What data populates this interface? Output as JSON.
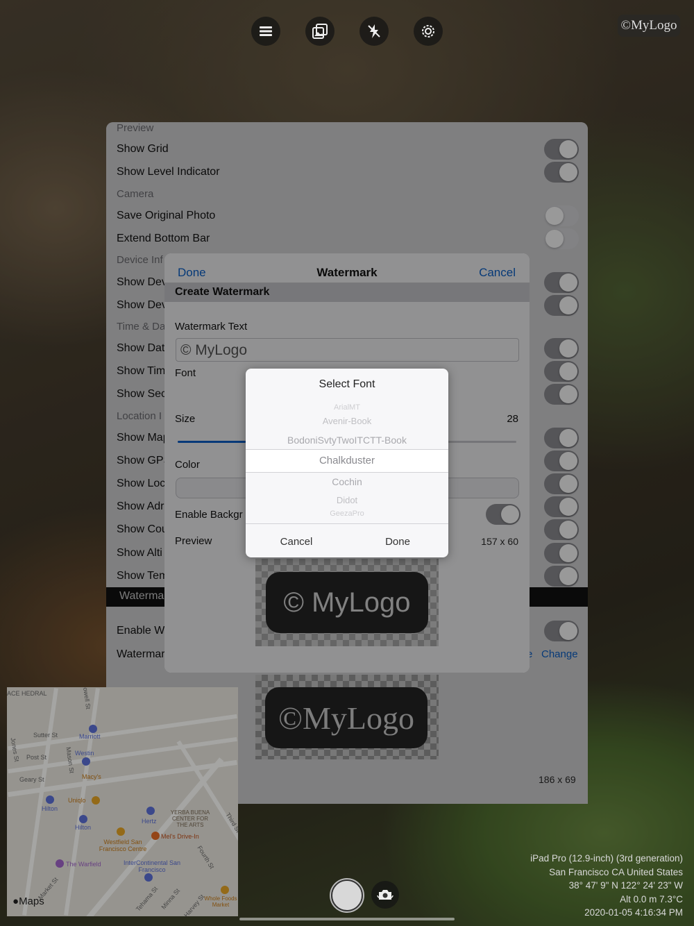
{
  "toolbar": {
    "buttons": [
      {
        "icon": "menu-icon"
      },
      {
        "icon": "gallery-icon"
      },
      {
        "icon": "flash-off-icon"
      },
      {
        "icon": "settings-gear-icon"
      }
    ],
    "watermark_badge": "©MyLogo"
  },
  "settings": {
    "sections": [
      {
        "type": "header",
        "label": "Preview"
      },
      {
        "type": "row",
        "label": "Show Grid",
        "toggle": true
      },
      {
        "type": "row",
        "label": "Show Level Indicator",
        "toggle": true
      },
      {
        "type": "header",
        "label": "Camera"
      },
      {
        "type": "row",
        "label": "Save Original Photo",
        "toggle": false
      },
      {
        "type": "row",
        "label": "Extend Bottom Bar",
        "toggle": false
      },
      {
        "type": "header",
        "label": "Device Inf"
      },
      {
        "type": "row",
        "label": "Show Dev",
        "toggle": true
      },
      {
        "type": "row",
        "label": "Show Dev",
        "toggle": true
      },
      {
        "type": "header",
        "label": "Time & Da"
      },
      {
        "type": "row",
        "label": "Show Dat",
        "toggle": true
      },
      {
        "type": "row",
        "label": "Show Tim",
        "toggle": true
      },
      {
        "type": "row",
        "label": "Show Sec",
        "toggle": true
      },
      {
        "type": "header",
        "label": "Location I"
      },
      {
        "type": "row",
        "label": "Show Map",
        "toggle": true
      },
      {
        "type": "row",
        "label": "Show GPS",
        "toggle": true
      },
      {
        "type": "row",
        "label": "Show Loc",
        "toggle": true
      },
      {
        "type": "row",
        "label": "Show Adr",
        "toggle": true
      },
      {
        "type": "row",
        "label": "Show Cou",
        "toggle": true
      },
      {
        "type": "row",
        "label": "Show Alti",
        "toggle": true
      },
      {
        "type": "row",
        "label": "Show Tem",
        "toggle": true
      }
    ],
    "watermark_section": "Waterma",
    "enable_watermark_label": "Enable Wa",
    "enable_watermark_on": true,
    "watermark_image_label": "Watermar",
    "link_fragment": "e",
    "change_link": "Change",
    "preview_text": "©MyLogo",
    "preview_dims": "186 x 69"
  },
  "dialog": {
    "done": "Done",
    "title": "Watermark",
    "cancel": "Cancel",
    "section": "Create Watermark",
    "text_label": "Watermark Text",
    "text_value": "© MyLogo",
    "font_label": "Font",
    "size_label": "Size",
    "size_value": "28",
    "size_fraction": 0.2,
    "color_label": "Color",
    "bg_label": "Enable Backgr",
    "bg_enabled": true,
    "preview_label": "Preview",
    "preview_dims": "157 x 60",
    "preview_text": "© MyLogo"
  },
  "picker": {
    "title": "Select Font",
    "items": [
      "ArialMT",
      "Avenir-Book",
      "BodoniSvtyTwoITCTT-Book",
      "Chalkduster",
      "Cochin",
      "Didot",
      "GeezaPro"
    ],
    "selected": "Chalkduster",
    "cancel": "Cancel",
    "done": "Done"
  },
  "map": {
    "streets": [
      "Sutter St",
      "Post St",
      "Geary St",
      "Jones St",
      "Mason St",
      "Powell St",
      "Market St",
      "Fourth St",
      "Third St",
      "Tehama St",
      "Minna St",
      "Harvey St"
    ],
    "pois": [
      "Marriott",
      "Westin",
      "Macy's",
      "Uniqlo",
      "Hilton",
      "Hilton",
      "Hertz",
      "YERBA BUENA CENTER FOR THE ARTS",
      "Mel's Drive-In",
      "Westfield San Francisco Centre",
      "The Warfield",
      "InterContinental San Francisco",
      "Whole Foods Market"
    ],
    "corner_label": "ACE HEDRAL",
    "logo": "Maps"
  },
  "info": {
    "device": "iPad Pro (12.9-inch) (3rd generation)",
    "location": "San Francisco CA United States",
    "coords": "38° 47' 9\" N 122° 24' 23\" W",
    "alt_temp": "Alt 0.0 m 7.3°C",
    "datetime": "2020-01-05 4:16:34 PM"
  }
}
